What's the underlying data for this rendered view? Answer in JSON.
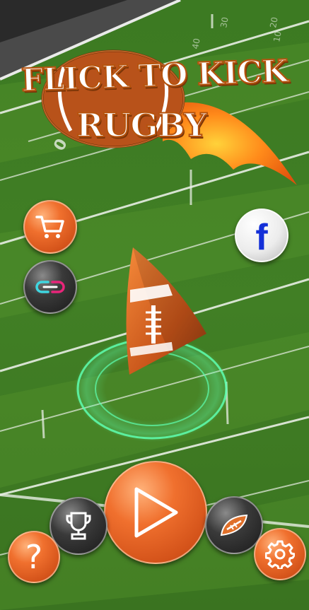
{
  "game": {
    "title_line1": "FLICK TO KICK",
    "title_line2": "RUGBY"
  },
  "field": {
    "yard_numbers": [
      "10",
      "20",
      "30",
      "40"
    ]
  },
  "buttons": {
    "shop": "cart-icon",
    "link": "link-icon",
    "facebook": "f",
    "play": "play-icon",
    "trophy": "trophy-icon",
    "ball_select": "rugby-ball-icon",
    "help": "?",
    "settings": "gear-icon"
  },
  "colors": {
    "accent_orange": "#e8662a",
    "grass_dark": "#3a7320",
    "grass_light": "#4f8d2c",
    "ring_glow": "#5effb0",
    "facebook_blue": "#1430d8"
  }
}
